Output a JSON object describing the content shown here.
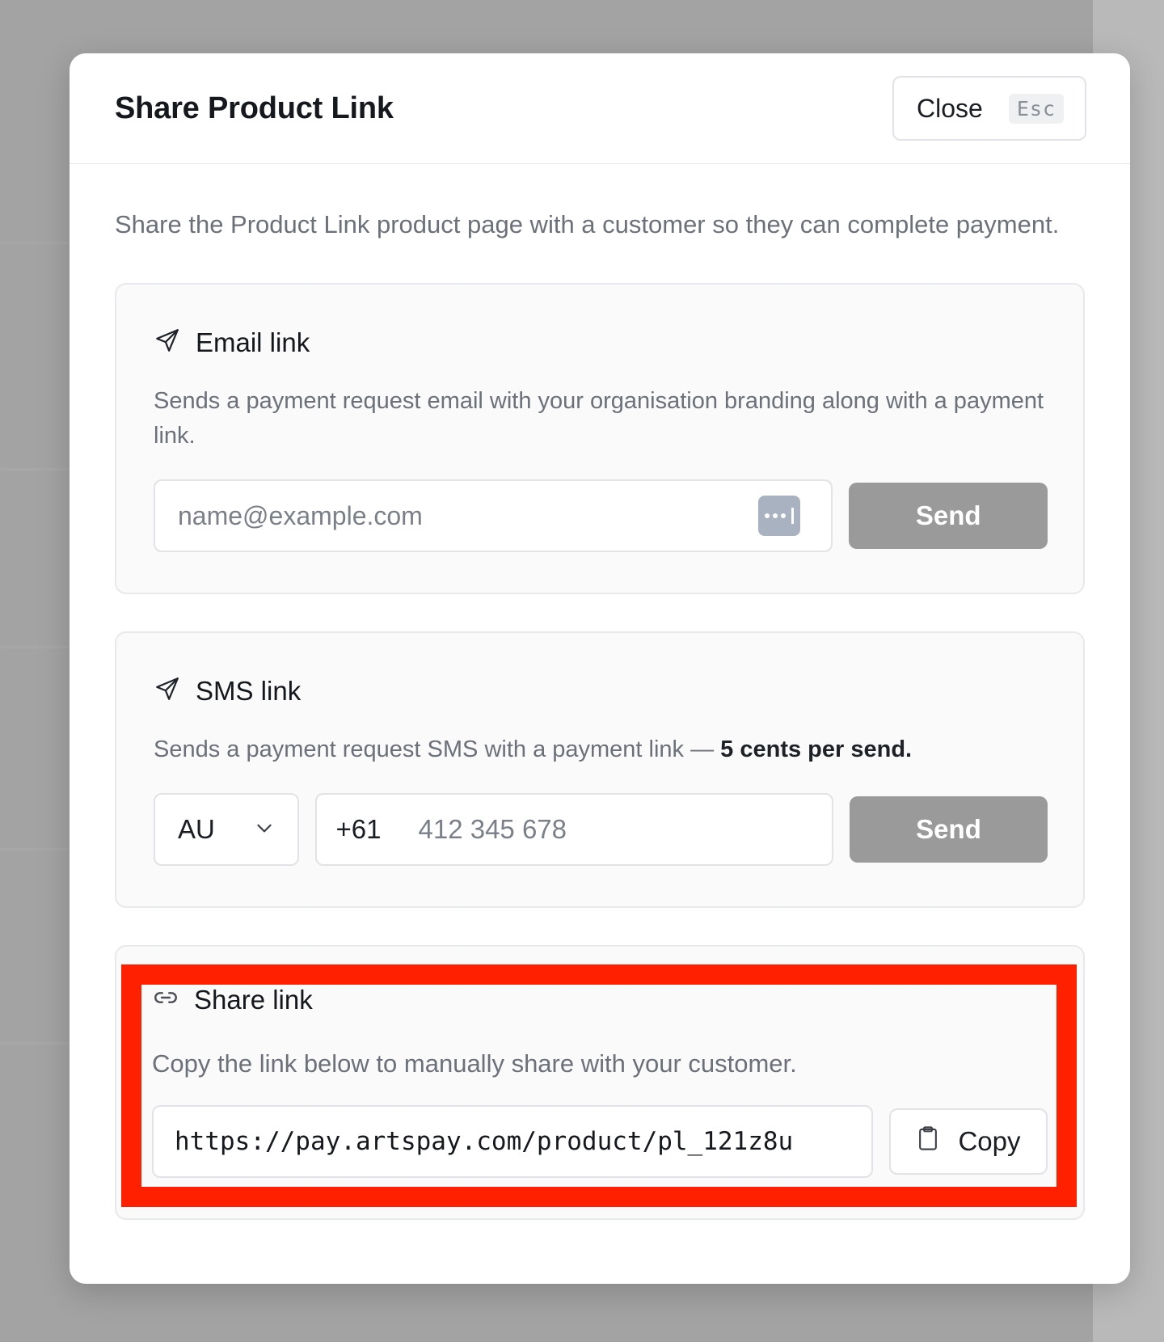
{
  "modal": {
    "title": "Share Product Link",
    "close_label": "Close",
    "close_shortcut": "Esc",
    "intro": "Share the Product Link product page with a customer so they can complete payment."
  },
  "email": {
    "icon": "send-icon",
    "title": "Email link",
    "description": "Sends a payment request email with your organisation branding along with a payment link.",
    "placeholder": "name@example.com",
    "send_label": "Send"
  },
  "sms": {
    "icon": "send-icon",
    "title": "SMS link",
    "description": "Sends a payment request SMS with a payment link — ",
    "description_strong": "5 cents per send.",
    "country": "AU",
    "dial_code": "+61",
    "placeholder": "412 345 678",
    "send_label": "Send"
  },
  "share": {
    "icon": "link-icon",
    "title": "Share link",
    "description": "Copy the link below to manually share with your customer.",
    "url": "https://pay.artspay.com/product/pl_121z8u",
    "copy_label": "Copy"
  },
  "colors": {
    "highlight": "#ff2000",
    "send_button": "#9a9a9a",
    "overlay": "#a3a3a3"
  }
}
